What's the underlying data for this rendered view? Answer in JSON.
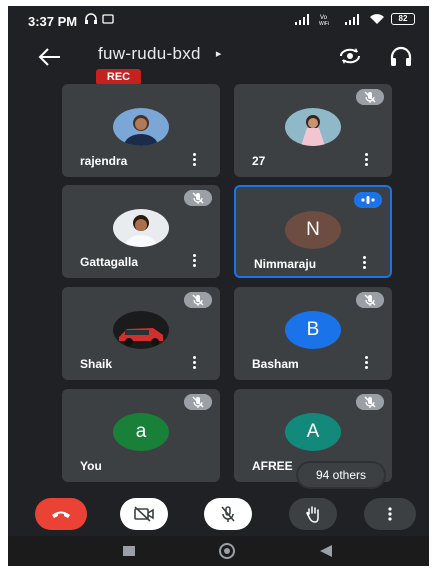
{
  "status_bar": {
    "time": "3:37 PM",
    "battery": "82",
    "wifi_label": "Vo WiFi"
  },
  "header": {
    "meeting_code": "fuw-rudu-bxd",
    "caret": "▸",
    "rec_label": "REC"
  },
  "participants": [
    {
      "name": "rajendra",
      "avatar_type": "photo",
      "muted": false,
      "speaking": false
    },
    {
      "name": "27",
      "avatar_type": "photo",
      "muted": true,
      "speaking": false
    },
    {
      "name": "Gattagalla",
      "avatar_type": "photo",
      "muted": true,
      "speaking": false
    },
    {
      "name": "Nimmaraju",
      "avatar_type": "letter",
      "letter": "N",
      "avatar_color": "#6d4c41",
      "muted": false,
      "speaking": true
    },
    {
      "name": "Shaik",
      "avatar_type": "photo",
      "muted": true,
      "speaking": false
    },
    {
      "name": "Basham",
      "avatar_type": "letter",
      "letter": "B",
      "avatar_color": "#1a73e8",
      "muted": true,
      "speaking": false
    },
    {
      "name": "You",
      "avatar_type": "letter",
      "letter": "a",
      "avatar_color": "#188038",
      "muted": true,
      "speaking": false
    },
    {
      "name": "AFREE",
      "avatar_type": "letter",
      "letter": "A",
      "avatar_color": "#12897a",
      "muted": true,
      "speaking": false
    }
  ],
  "others_chip": "94 others",
  "controls": [
    "end-call-icon",
    "camera-off-icon",
    "mic-off-icon",
    "raise-hand-icon",
    "more-vert-icon"
  ],
  "colors": {
    "background": "#202124",
    "tile": "#3c4043",
    "accent": "#1a73e8",
    "danger": "#ea4335",
    "rec": "#c5221f"
  }
}
